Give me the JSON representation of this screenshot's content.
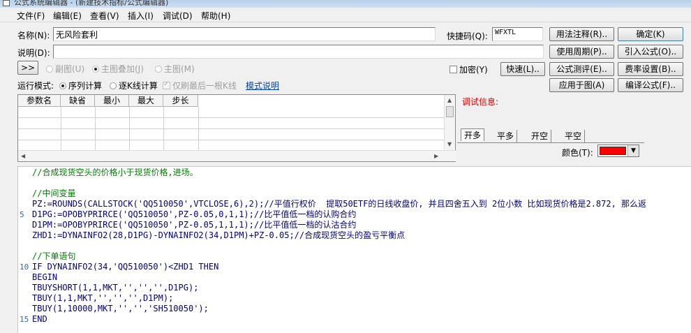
{
  "window": {
    "title": "公式系统编辑器 - (新建技术指标/公式编辑器)"
  },
  "menu": [
    "文件(F)",
    "编辑(E)",
    "查看(V)",
    "插入(I)",
    "调试(D)",
    "帮助(H)"
  ],
  "form": {
    "name_label": "名称(N):",
    "name_value": "无风险套利",
    "shortcut_label": "快捷码(Q):",
    "shortcut_value": "WFXTL",
    "desc_label": "说明(D):",
    "desc_value": "",
    "expand_btn": ">>",
    "radio_subchart": "副图(U)",
    "radio_main_overlay": "主图叠加(J)",
    "radio_main": "主图(M)",
    "encrypt_label": "加密(Y)",
    "run_mode_label": "运行模式:",
    "run_serial": "序列计算",
    "run_tick": "逐K线计算",
    "only_last": "仅刷最后一根K线",
    "mode_help": "模式说明"
  },
  "buttons": {
    "usage_note": "用法注释(R)..",
    "confirm": "确定(K)",
    "period": "使用周期(P)..",
    "import": "引入公式(O)..",
    "quick": "快速(L)..",
    "test": "公式测评(E)..",
    "fee": "费率设置(B)..",
    "apply_chart": "应用于图(A)",
    "compile": "编译公式(F).."
  },
  "params": {
    "headers": [
      "参数名",
      "缺省",
      "最小",
      "最大",
      "步长"
    ]
  },
  "debug": {
    "label": "调试信息:"
  },
  "signal_tabs": [
    "开多",
    "平多",
    "开空",
    "平空"
  ],
  "color": {
    "label": "颜色(T):",
    "value": "#ff0000"
  },
  "code": {
    "line_numbers": [
      "5",
      "10",
      "15"
    ],
    "lines": [
      "//合成现货空头的价格小于现货价格,进场。",
      "",
      "//中间变量",
      "PZ:=ROUNDS(CALLSTOCK('QQ510050',VTCLOSE,6),2);//平值行权价  提取50ETF的日线收盘价, 并且四舍五入到 2位小数 比如现货价格是2.872, 那么返",
      "D1PG:=OPOBYPRIRCE('QQ510050',PZ-0.05,0,1,1);//比平值低一档的认购合约",
      "D1PM:=OPOBYPRIRCE('QQ510050',PZ-0.05,1,1,1);//比平值低一档的认沽合约",
      "ZHD1:=DYNAINFO2(28,D1PG)-DYNAINFO2(34,D1PM)+PZ-0.05;//合成现货空头的盈亏平衡点",
      "",
      "//下单语句",
      "IF DYNAINFO2(34,'QQ510050')<ZHD1 THEN",
      "BEGIN",
      "TBUYSHORT(1,1,MKT,'','','',D1PG);",
      "TBUY(1,1,MKT,'','','',D1PM);",
      "TBUY(1,10000,MKT,'','','SH510050');",
      "END"
    ]
  }
}
